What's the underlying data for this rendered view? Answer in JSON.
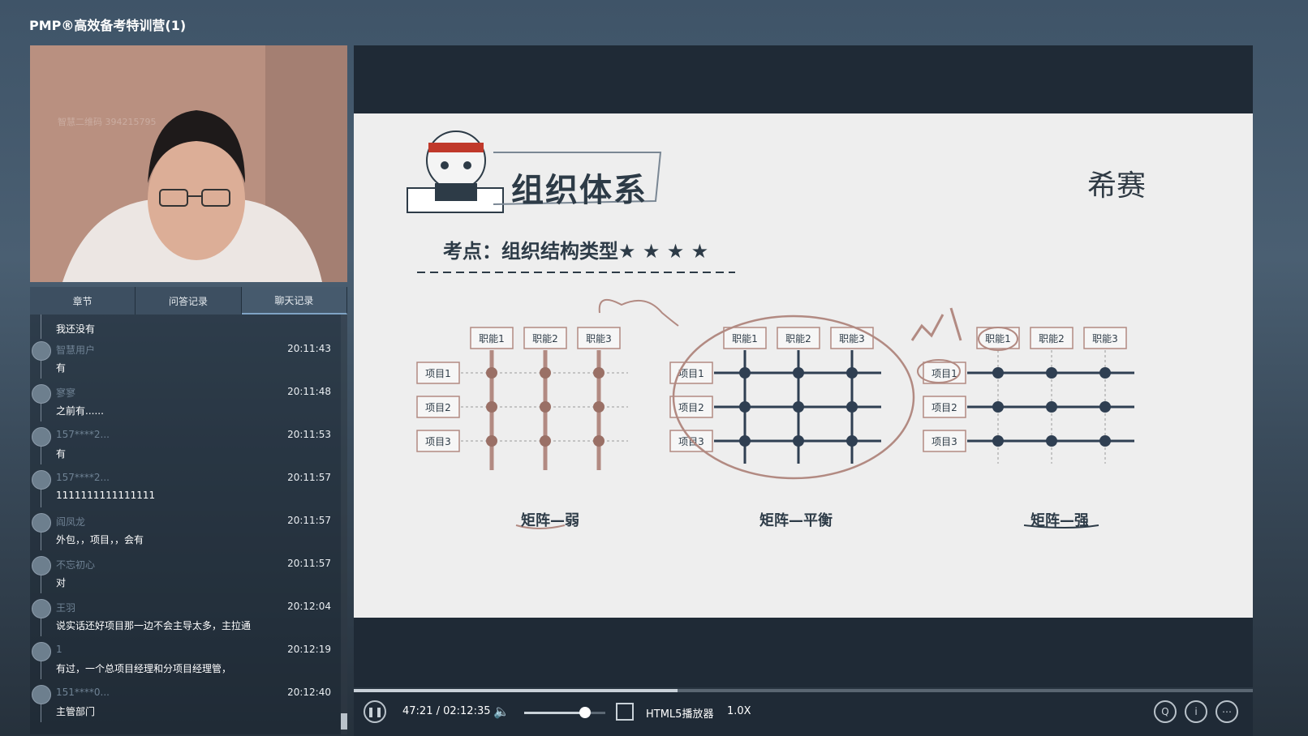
{
  "app": {
    "title": "PMP®高效备考特训营(1)"
  },
  "camera": {
    "watermark": "智慧二维码 394215795"
  },
  "tabs": [
    {
      "label": "章节",
      "active": false
    },
    {
      "label": "问答记录",
      "active": false
    },
    {
      "label": "聊天记录",
      "active": true
    }
  ],
  "chat": [
    {
      "name": "",
      "time": "",
      "text": "我还没有"
    },
    {
      "name": "智慧用户",
      "time": "20:11:43",
      "text": "有"
    },
    {
      "name": "寥寥",
      "time": "20:11:48",
      "text": "之前有......"
    },
    {
      "name": "157****2...",
      "time": "20:11:53",
      "text": "有"
    },
    {
      "name": "157****2...",
      "time": "20:11:57",
      "text": "1111111111111111"
    },
    {
      "name": "阎凤龙",
      "time": "20:11:57",
      "text": "外包，，项目，，会有"
    },
    {
      "name": "不忘初心",
      "time": "20:11:57",
      "text": "对"
    },
    {
      "name": "王羽",
      "time": "20:12:04",
      "text": "说实话还好项目那一边不会主导太多，主拉通"
    },
    {
      "name": "1",
      "time": "20:12:19",
      "text": "有过，一个总项目经理和分项目经理管，"
    },
    {
      "name": "151****0...",
      "time": "20:12:40",
      "text": "主管部门"
    }
  ],
  "slide": {
    "title": "组织体系",
    "logo": "希赛",
    "topic": "考点：组织结构类型★ ★ ★ ★",
    "functions": [
      "职能1",
      "职能2",
      "职能3"
    ],
    "projects": [
      "项目1",
      "项目2",
      "项目3"
    ],
    "captions": [
      "矩阵—弱",
      "矩阵—平衡",
      "矩阵—强"
    ]
  },
  "player": {
    "time": "47:21 / 02:12:35",
    "player_name": "HTML5播放器",
    "speed": "1.0X",
    "progress": 0.36,
    "volume": 0.75
  },
  "colors": {
    "accent": "#b28a82",
    "matrix": "#2f3f52"
  }
}
